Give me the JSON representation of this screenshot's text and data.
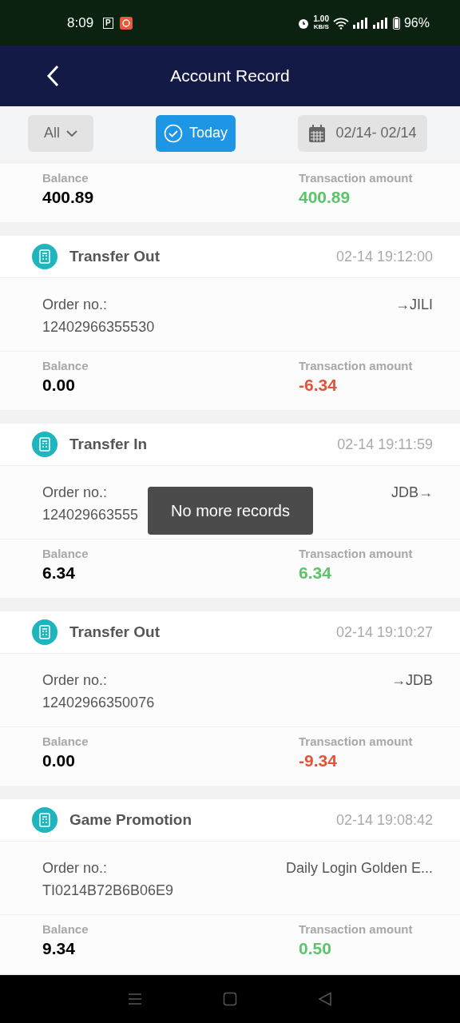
{
  "status_bar": {
    "time": "8:09",
    "parking_badge": "P",
    "speed_value": "1.00",
    "speed_unit": "KB/S",
    "battery": "96%"
  },
  "header": {
    "title": "Account Record"
  },
  "filters": {
    "type_dropdown": "All",
    "today": {
      "label": "Today",
      "selected": true
    },
    "date_range": "02/14- 02/14"
  },
  "top_partial": {
    "balance_label": "Balance",
    "balance": "400.89",
    "amount_label": "Transaction amount",
    "amount": "400.89",
    "color": "#5cc46a"
  },
  "records": [
    {
      "title": "Transfer Out",
      "time": "02-14 19:12:00",
      "order_label": "Order no.:",
      "order_no": "12402966355530",
      "target": "→JILI",
      "balance_label": "Balance",
      "balance": "0.00",
      "amount_label": "Transaction amount",
      "amount": "-6.34",
      "color": "#e0553a"
    },
    {
      "title": "Transfer In",
      "time": "02-14 19:11:59",
      "order_label": "Order no.:",
      "order_no": "124029663555",
      "target": "JDB→",
      "balance_label": "Balance",
      "balance": "6.34",
      "amount_label": "Transaction amount",
      "amount": "6.34",
      "color": "#5cc46a"
    },
    {
      "title": "Transfer Out",
      "time": "02-14 19:10:27",
      "order_label": "Order no.:",
      "order_no": "12402966350076",
      "target": "→JDB",
      "balance_label": "Balance",
      "balance": "0.00",
      "amount_label": "Transaction amount",
      "amount": "-9.34",
      "color": "#e0553a"
    },
    {
      "title": "Game Promotion",
      "time": "02-14 19:08:42",
      "order_label": "Order no.:",
      "order_no": "TI0214B72B6B06E9",
      "target": "Daily Login Golden E...",
      "balance_label": "Balance",
      "balance": "9.34",
      "amount_label": "Transaction amount",
      "amount": "0.50",
      "color": "#5cc46a"
    }
  ],
  "toast": "No more records"
}
